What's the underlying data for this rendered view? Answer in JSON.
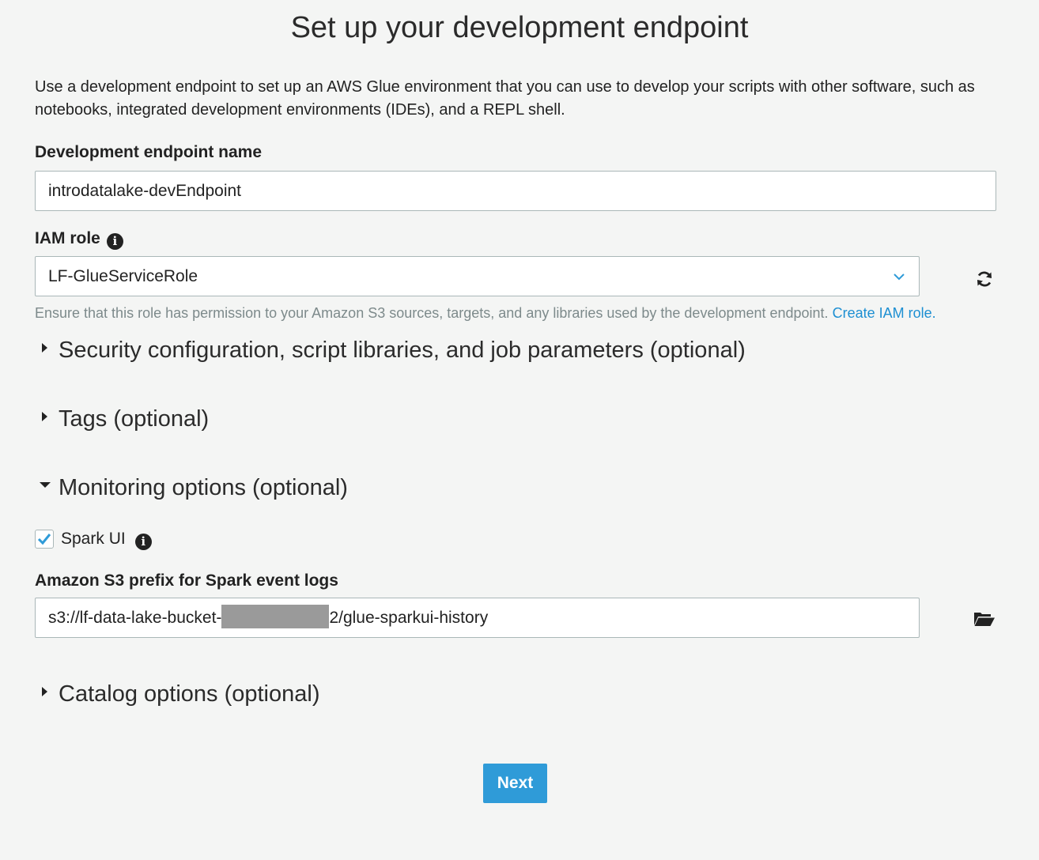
{
  "page": {
    "title": "Set up your development endpoint",
    "intro": "Use a development endpoint to set up an AWS Glue environment that you can use to develop your scripts with other software, such as notebooks, integrated development environments (IDEs), and a REPL shell."
  },
  "endpoint_name": {
    "label": "Development endpoint name",
    "value": "introdatalake-devEndpoint"
  },
  "iam_role": {
    "label": "IAM role",
    "selected": "LF-GlueServiceRole",
    "hint": "Ensure that this role has permission to your Amazon S3 sources, targets, and any libraries used by the development endpoint.",
    "create_link": "Create IAM role."
  },
  "sections": {
    "security": "Security configuration, script libraries, and job parameters (optional)",
    "tags": "Tags (optional)",
    "monitoring": "Monitoring options (optional)",
    "catalog": "Catalog options (optional)"
  },
  "monitoring": {
    "spark_ui_label": "Spark UI",
    "spark_ui_checked": true,
    "s3_prefix_label": "Amazon S3 prefix for Spark event logs",
    "s3_prefix_start": "s3://lf-data-lake-bucket-",
    "s3_prefix_end": "2/glue-sparkui-history"
  },
  "actions": {
    "next_label": "Next"
  },
  "colors": {
    "accent": "#2f9bd8",
    "link": "#1d8fd2",
    "background": "#f4f5f4"
  }
}
